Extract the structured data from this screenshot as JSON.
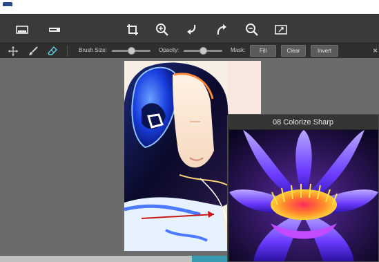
{
  "toolbar": {
    "icons": [
      "image-icon",
      "panel-icon",
      "crop-icon",
      "zoom-in-icon",
      "undo-icon",
      "redo-icon",
      "zoom-out-icon",
      "fit-screen-icon"
    ]
  },
  "options": {
    "tools": [
      "move-icon",
      "brush-icon",
      "eraser-icon"
    ],
    "brush_size_label": "Brush Size:",
    "opacity_label": "Opacity:",
    "mask_label": "Mask:",
    "fill_label": "Fill",
    "clear_label": "Clear",
    "invert_label": "Invert",
    "close_glyph": "×",
    "brush_size_level": 0.5,
    "opacity_level": 0.5
  },
  "preview": {
    "title": "08 Colorize Sharp"
  },
  "colors": {
    "accent": "#3a9ab0",
    "toolbar_bg": "#3a3a3a",
    "canvas_bg": "#6b6b6b"
  }
}
